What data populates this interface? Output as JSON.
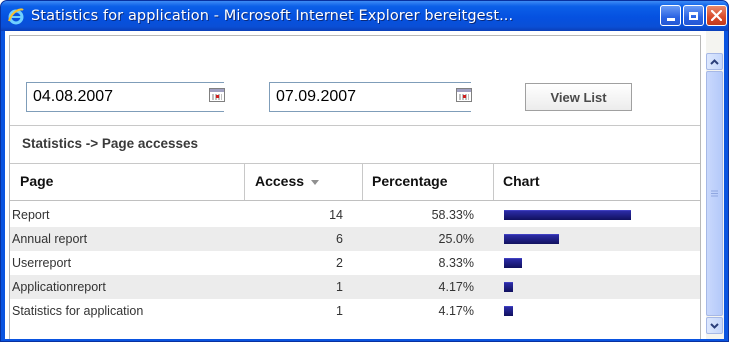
{
  "window": {
    "title": "Statistics for application - Microsoft Internet Explorer bereitgest...",
    "icon": "ie-icon",
    "controls": [
      "minimize-icon",
      "maximize-icon",
      "close-icon"
    ]
  },
  "filter": {
    "from_date": "04.08.2007",
    "to_date": "07.09.2007",
    "calendar_icon": "calendar-icon",
    "view_button_label": "View List"
  },
  "section_title": "Statistics -> Page accesses",
  "table": {
    "columns": {
      "page": "Page",
      "access": "Access",
      "percentage": "Percentage",
      "chart": "Chart"
    },
    "sort": {
      "column": "Access",
      "direction": "descending"
    },
    "rows": [
      {
        "page": "Report",
        "access": "14",
        "percentage": "58.33%",
        "share": 0.5833
      },
      {
        "page": "Annual report",
        "access": "6",
        "percentage": "25.0%",
        "share": 0.25
      },
      {
        "page": "Userreport",
        "access": "2",
        "percentage": "8.33%",
        "share": 0.0833
      },
      {
        "page": "Applicationreport",
        "access": "1",
        "percentage": "4.17%",
        "share": 0.0417
      },
      {
        "page": "Statistics for application",
        "access": "1",
        "percentage": "4.17%",
        "share": 0.0417
      }
    ]
  },
  "colors": {
    "titlebar": "#0551e0",
    "bar": "#1a1a80",
    "alt_row": "#ececec"
  }
}
